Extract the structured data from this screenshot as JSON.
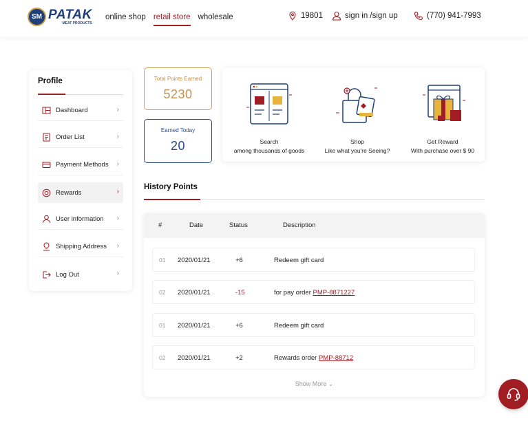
{
  "brand": {
    "badge": "SM",
    "name": "PATAK",
    "subtitle": "MEAT PRODUCTS"
  },
  "nav": [
    "online shop",
    "retail store",
    "wholesale"
  ],
  "nav_active": "retail store",
  "header_right": {
    "zip": "19801",
    "sign": "sign in /sign up",
    "phone": "(770) 941-7993"
  },
  "sidebar": {
    "title": "Profile",
    "items": [
      {
        "label": "Dashboard",
        "icon": "dashboard-icon"
      },
      {
        "label": "Order List",
        "icon": "order-list-icon"
      },
      {
        "label": "Payment Methods",
        "icon": "credit-card-icon"
      },
      {
        "label": "Rewards",
        "icon": "reward-icon",
        "active": true
      },
      {
        "label": "User information",
        "icon": "user-icon"
      },
      {
        "label": "Shipping Address",
        "icon": "location-user-icon"
      },
      {
        "label": "Log Out",
        "icon": "logout-icon"
      }
    ],
    "chevron": "›"
  },
  "points": {
    "total_label": "Total Points Earned",
    "total_value": "5230",
    "today_label": "Earned Today",
    "today_value": "20"
  },
  "how_it_works": [
    {
      "title": "Search",
      "sub": "among thousands of goods",
      "icon": "search-shop-illustration"
    },
    {
      "title": "Shop",
      "sub": "Like what you're Seeing?",
      "icon": "shopping-bag-illustration"
    },
    {
      "title": "Get Reward",
      "sub": "With purchase over $ 90",
      "icon": "gift-reward-illustration"
    }
  ],
  "history": {
    "title": "History Points",
    "columns": [
      "#",
      "Date",
      "Status",
      "Description"
    ],
    "rows": [
      {
        "num": "01",
        "date": "2020/01/21",
        "status": "+6",
        "negative": false,
        "desc": "Redeem gift card",
        "order": ""
      },
      {
        "num": "02",
        "date": "2020/01/21",
        "status": "-15",
        "negative": true,
        "desc": "for pay order ",
        "order": "PMP-8871227"
      },
      {
        "num": "01",
        "date": "2020/01/21",
        "status": "+6",
        "negative": false,
        "desc": "Redeem gift card",
        "order": ""
      },
      {
        "num": "02",
        "date": "2020/01/21",
        "status": "+2",
        "negative": false,
        "desc": "Rewards order ",
        "order": "PMP-88712"
      }
    ],
    "show_more": "Show More",
    "show_more_chevron": "⌄"
  },
  "colors": {
    "accent": "#a11d24",
    "brand_blue": "#1e3f7a",
    "gold": "#c8904a"
  }
}
